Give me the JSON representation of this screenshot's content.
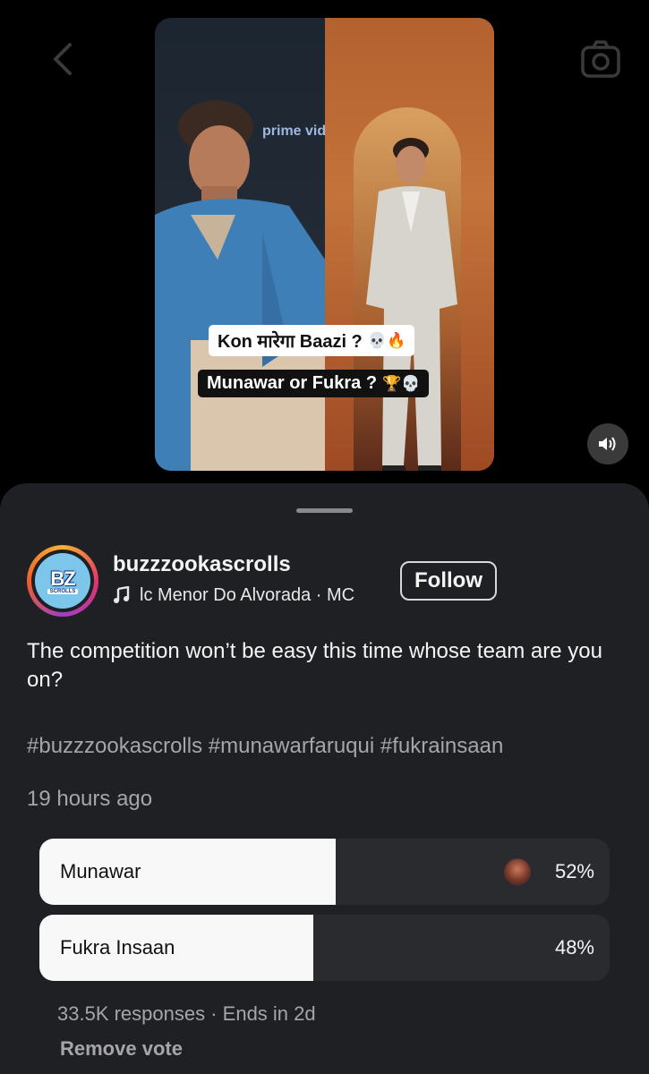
{
  "video": {
    "board_text": "prime vid",
    "caption_line1": "Kon मारेगा Baazi ?",
    "caption_line1_emoji": "💀🔥",
    "caption_line2": "Munawar or Fukra ?",
    "caption_line2_emoji": "🏆💀"
  },
  "post": {
    "avatar_logo": "BZ",
    "avatar_sub": "SCROLLS",
    "username": "buzzzookascrolls",
    "audio": "lc Menor Do Alvorada · MC",
    "follow_label": "Follow",
    "caption": "The competition won’t be easy this time whose team are you on?",
    "hashtags": "#buzzzookascrolls #munawarfaruqui #fukrainsaan",
    "time_ago": "19 hours ago"
  },
  "poll": {
    "options": [
      {
        "label": "Munawar",
        "percent_text": "52%",
        "fill": 0.52
      },
      {
        "label": "Fukra Insaan",
        "percent_text": "48%",
        "fill": 0.48
      }
    ],
    "meta": "33.5K responses · Ends in 2d",
    "remove_vote": "Remove vote"
  },
  "colors": {
    "sheet_bg": "#1f2023",
    "poll_fill": "#f8f8f8",
    "muted_text": "#a5a5aa"
  },
  "icons": [
    "back-chevron-icon",
    "camera-icon",
    "speaker-icon",
    "music-note-icon"
  ]
}
